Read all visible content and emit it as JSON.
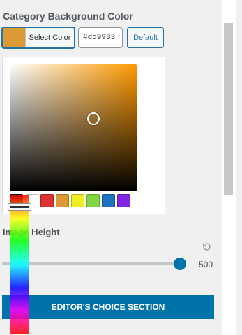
{
  "section": {
    "title": "Category Background Color"
  },
  "color_control": {
    "select_label": "Select Color",
    "hex_value": "#dd9933",
    "default_label": "Default",
    "current_color": "#dd9933"
  },
  "picker": {
    "hue_color": "#ff9900",
    "palette": [
      {
        "name": "black",
        "color": "#000000"
      },
      {
        "name": "white",
        "color": "#ffffff"
      },
      {
        "name": "red",
        "color": "#dd3333"
      },
      {
        "name": "orange",
        "color": "#dd9933"
      },
      {
        "name": "yellow",
        "color": "#eeee22"
      },
      {
        "name": "green",
        "color": "#81d742"
      },
      {
        "name": "blue",
        "color": "#1e73be"
      },
      {
        "name": "purple",
        "color": "#8224e3"
      }
    ]
  },
  "image_height": {
    "label": "Image Height",
    "value": "500",
    "reset_icon": "reset-icon"
  },
  "banner": {
    "label": "EDITOR'S CHOICE SECTION",
    "color": "#0073aa"
  }
}
